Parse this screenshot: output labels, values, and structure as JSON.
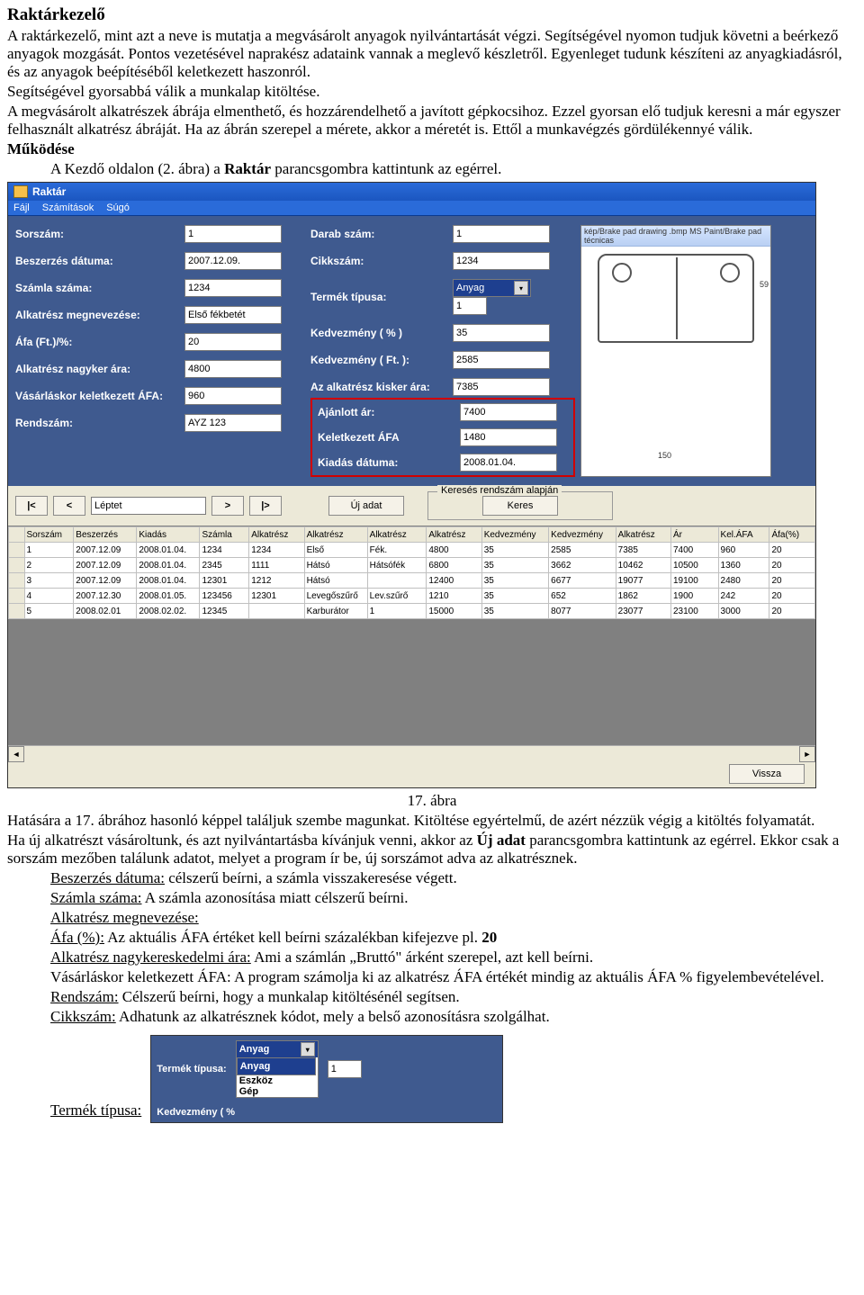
{
  "title": "Raktárkezelő",
  "intro": [
    "A raktárkezelő, mint azt a neve is mutatja a megvásárolt anyagok nyilvántartását végzi. Segítségével nyomon tudjuk követni a beérkező anyagok mozgását. Pontos vezetésével naprakész adataink vannak a meglevő készletről. Egyenleget tudunk készíteni az anyagkiadásról, és az anyagok beépítéséből keletkezett haszonról.",
    "Segítségével gyorsabbá válik a munkalap kitöltése.",
    "A megvásárolt alkatrészek ábrája elmenthető, és hozzárendelhető a javított gépkocsihoz. Ezzel gyorsan elő tudjuk keresni a már egyszer felhasznált alkatrész ábráját. Ha az ábrán szerepel a mérete, akkor a méretét is. Ettől a munkavégzés gördülékennyé válik."
  ],
  "mukodese_label": "Működése",
  "mukodese_line": "A Kezdő oldalon (2. ábra) a ",
  "mukodese_bold": "Raktár",
  "mukodese_after": " parancsgombra kattintunk az egérrel.",
  "shot": {
    "title": "Raktár",
    "menu": [
      "Fájl",
      "Számítások",
      "Súgó"
    ],
    "left": {
      "sorszam_l": "Sorszám:",
      "sorszam_v": "1",
      "beszerzes_l": "Beszerzés dátuma:",
      "beszerzes_v": "2007.12.09.",
      "szamla_l": "Számla száma:",
      "szamla_v": "1234",
      "megnev_l": "Alkatrész megnevezése:",
      "megnev_v": "Első fékbetét",
      "afa_l": "Áfa (Ft.)/%:",
      "afa_v": "20",
      "nagyker_l": "Alkatrész nagyker ára:",
      "nagyker_v": "4800",
      "vafa_l": "Vásárláskor keletkezett ÁFA:",
      "vafa_v": "960",
      "rendszam_l": "Rendszám:",
      "rendszam_v": "AYZ 123"
    },
    "right": {
      "darab_l": "Darab szám:",
      "darab_v": "1",
      "cikk_l": "Cikkszám:",
      "cikk_v": "1234",
      "tipus_l": "Termék típusa:",
      "tipus_v": "Anyag",
      "tipus_extra": "1",
      "kedvp_l": "Kedvezmény ( % )",
      "kedvp_v": "35",
      "kedvf_l": "Kedvezmény ( Ft. ):",
      "kedvf_v": "2585",
      "kisker_l": "Az alkatrész kisker ára:",
      "kisker_v": "7385",
      "ajan_l": "Ajánlott ár:",
      "ajan_v": "7400",
      "kafa_l": "Keletkezett ÁFA",
      "kafa_v": "1480",
      "kiad_l": "Kiadás dátuma:",
      "kiad_v": "2008.01.04."
    },
    "img_title": "kép/Brake pad drawing .bmp  MS Paint/Brake pad técnicas",
    "dim_w": "150",
    "dim_h": "59",
    "nav": {
      "first": "|<",
      "prev": "<",
      "step": "Léptet",
      "next": ">",
      "last": "|>",
      "uj": "Új adat"
    },
    "search_legend": "Keresés rendszám alapján",
    "search_btn": "Keres",
    "headers": [
      "",
      "Sorszám",
      "Beszerzés",
      "Kiadás",
      "Számla",
      "Alkatrész",
      "Alkatrész",
      "Alkatrész",
      "Alkatrész",
      "Kedvezmény",
      "Kedvezmény",
      "Alkatrész",
      "Ár",
      "Kel.ÁFA",
      "Áfa(%)"
    ],
    "rows": [
      [
        "",
        "1",
        "2007.12.09",
        "2008.01.04.",
        "1234",
        "1234",
        "Első",
        "Fék.",
        "4800",
        "35",
        "2585",
        "7385",
        "7400",
        "960",
        "20"
      ],
      [
        "",
        "2",
        "2007.12.09",
        "2008.01.04.",
        "2345",
        "1111",
        "Hátsó",
        "Hátsófék",
        "6800",
        "35",
        "3662",
        "10462",
        "10500",
        "1360",
        "20"
      ],
      [
        "",
        "3",
        "2007.12.09",
        "2008.01.04.",
        "12301",
        "1212",
        "Hátsó",
        "",
        "12400",
        "35",
        "6677",
        "19077",
        "19100",
        "2480",
        "20"
      ],
      [
        "",
        "4",
        "2007.12.30",
        "2008.01.05.",
        "123456",
        "12301",
        "Levegőszűrő",
        "Lev.szűrő",
        "1210",
        "35",
        "652",
        "1862",
        "1900",
        "242",
        "20"
      ],
      [
        "",
        "5",
        "2008.02.01",
        "2008.02.02.",
        "12345",
        "",
        "Karburátor",
        "1",
        "15000",
        "35",
        "8077",
        "23077",
        "23100",
        "3000",
        "20"
      ]
    ],
    "vissza": "Vissza"
  },
  "fig_caption": "17. ábra",
  "after": {
    "p1a": "Hatására a 17. ábrához hasonló képpel találjuk szembe magunkat. Kitöltése egyértelmű, de azért nézzük végig a kitöltés folyamatát.",
    "p2a": "Ha új alkatrészt vásároltunk, és azt nyilvántartásba kívánjuk venni, akkor az ",
    "p2b": "Új adat",
    "p2c": " parancsgombra kattintunk az egérrel. Ekkor csak a sorszám mezőben találunk adatot, melyet a program ír be, új sorszámot adva az alkatrésznek.",
    "l1u": "Beszerzés dátuma:",
    "l1": " célszerű beírni, a számla visszakeresése végett.",
    "l2u": "Számla száma:",
    "l2": " A számla azonosítása miatt célszerű beírni.",
    "l3u": "Alkatrész megnevezése:",
    "l4u": "Áfa (%):",
    "l4a": " Az aktuális ÁFA értéket kell beírni százalékban kifejezve pl. ",
    "l4b": "20",
    "l5u": "Alkatrész nagykereskedelmi ára:",
    "l5": " Ami a számlán „Bruttó\" árként szerepel, azt kell beírni.",
    "l6a": "Vásárláskor keletkezett ÁFA: A program számolja ki az alkatrész ÁFA értékét mindig az aktuális ÁFA % figyelembevételével.",
    "l7u": "Rendszám:",
    "l7": " Célszerű beírni, hogy a munkalap kitöltésénél segítsen.",
    "l8u": "Cikkszám:",
    "l8": " Adhatunk az alkatrésznek kódot, mely a belső azonosításra szolgálhat."
  },
  "shot2": {
    "tipus_l": "Termék típusa:",
    "sel": "Anyag",
    "extra": "1",
    "opts": [
      "Anyag",
      "Eszköz",
      "Gép"
    ],
    "kedv_l": "Kedvezmény ( %"
  },
  "termek_label": "Termék típusa:"
}
